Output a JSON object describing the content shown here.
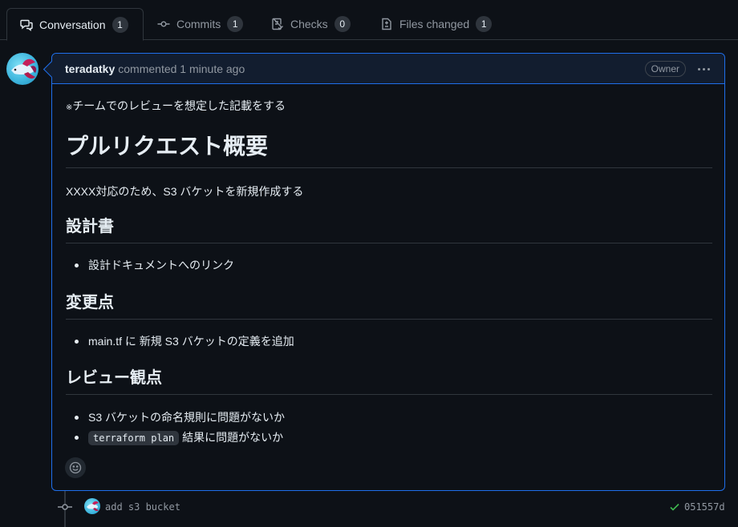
{
  "tabs": [
    {
      "label": "Conversation",
      "count": "1",
      "icon": "conversation-icon",
      "active": true
    },
    {
      "label": "Commits",
      "count": "1",
      "icon": "commit-icon"
    },
    {
      "label": "Checks",
      "count": "0",
      "icon": "checklist-icon"
    },
    {
      "label": "Files changed",
      "count": "1",
      "icon": "file-diff-icon"
    }
  ],
  "comment": {
    "author": "teradatky",
    "action": "commented 1 minute ago",
    "badge": "Owner",
    "note_mark": "※",
    "note": "チームでのレビューを想定した記載をする",
    "title": "プルリクエスト概要",
    "summary": "XXXX対応のため、S3 バケットを新規作成する",
    "sections": [
      {
        "heading": "設計書",
        "items": [
          "設計ドキュメントへのリンク"
        ]
      },
      {
        "heading": "変更点",
        "items": [
          "main.tf に 新規 S3 バケットの定義を追加"
        ]
      },
      {
        "heading": "レビュー観点",
        "items": [
          "S3 バケットの命名規則に問題がないか"
        ],
        "code_item": {
          "code": "terraform plan",
          "text": "結果に問題がないか"
        }
      }
    ]
  },
  "commit": {
    "message": "add s3 bucket",
    "sha": "051557d",
    "status_color": "#3fb950"
  },
  "colors": {
    "accent": "#1f6feb",
    "background": "#0d1117"
  }
}
